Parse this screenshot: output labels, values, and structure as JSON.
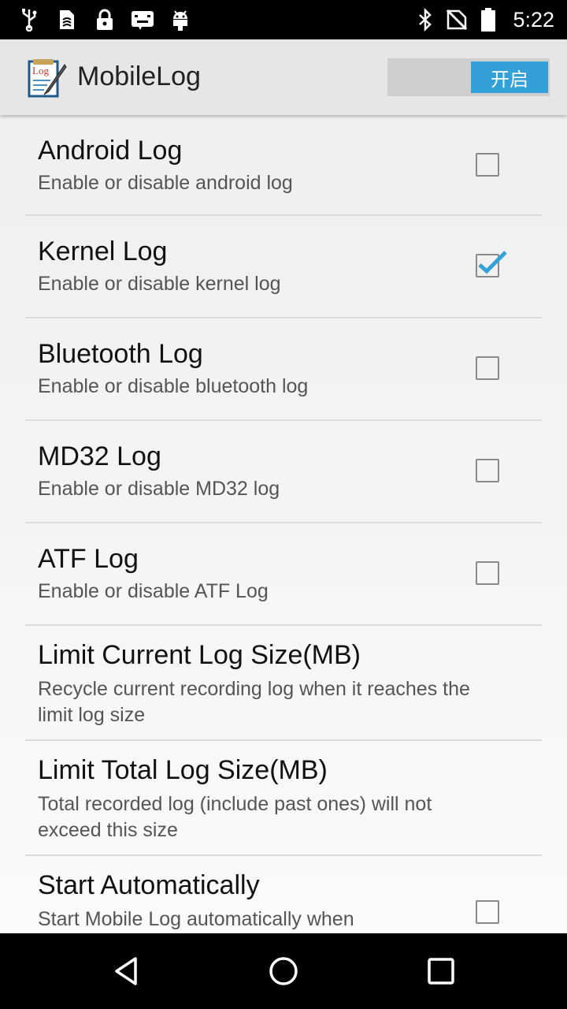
{
  "status_bar": {
    "left_icons": [
      "usb-icon",
      "sim-card-icon",
      "lock-icon",
      "keyboard-icon",
      "android-debug-icon"
    ],
    "right_icons": [
      "bluetooth-icon",
      "no-signal-icon",
      "battery-icon"
    ],
    "time": "5:22"
  },
  "action_bar": {
    "title": "MobileLog",
    "app_icon_label": "Log",
    "toggle_label": "开启",
    "toggle_state": "on",
    "accent_color": "#33a0d8"
  },
  "preferences": [
    {
      "title": "Android Log",
      "summary": "Enable or disable android log",
      "checked": false
    },
    {
      "title": "Kernel Log",
      "summary": "Enable or disable kernel log",
      "checked": true
    },
    {
      "title": "Bluetooth Log",
      "summary": "Enable or disable bluetooth log",
      "checked": false
    },
    {
      "title": "MD32 Log",
      "summary": "Enable or disable MD32 log",
      "checked": false
    },
    {
      "title": "ATF Log",
      "summary": "Enable or disable ATF Log",
      "checked": false
    },
    {
      "title": "Limit Current Log Size(MB)",
      "summary": "Recycle current recording log when it reaches the limit log size"
    },
    {
      "title": "Limit Total Log Size(MB)",
      "summary": "Total recorded log (include past ones) will not exceed this size"
    },
    {
      "title": "Start Automatically",
      "summary": "Start Mobile Log automatically when",
      "checked": false
    }
  ],
  "nav_bar": {
    "buttons": [
      "back-icon",
      "home-icon",
      "recents-icon"
    ]
  }
}
